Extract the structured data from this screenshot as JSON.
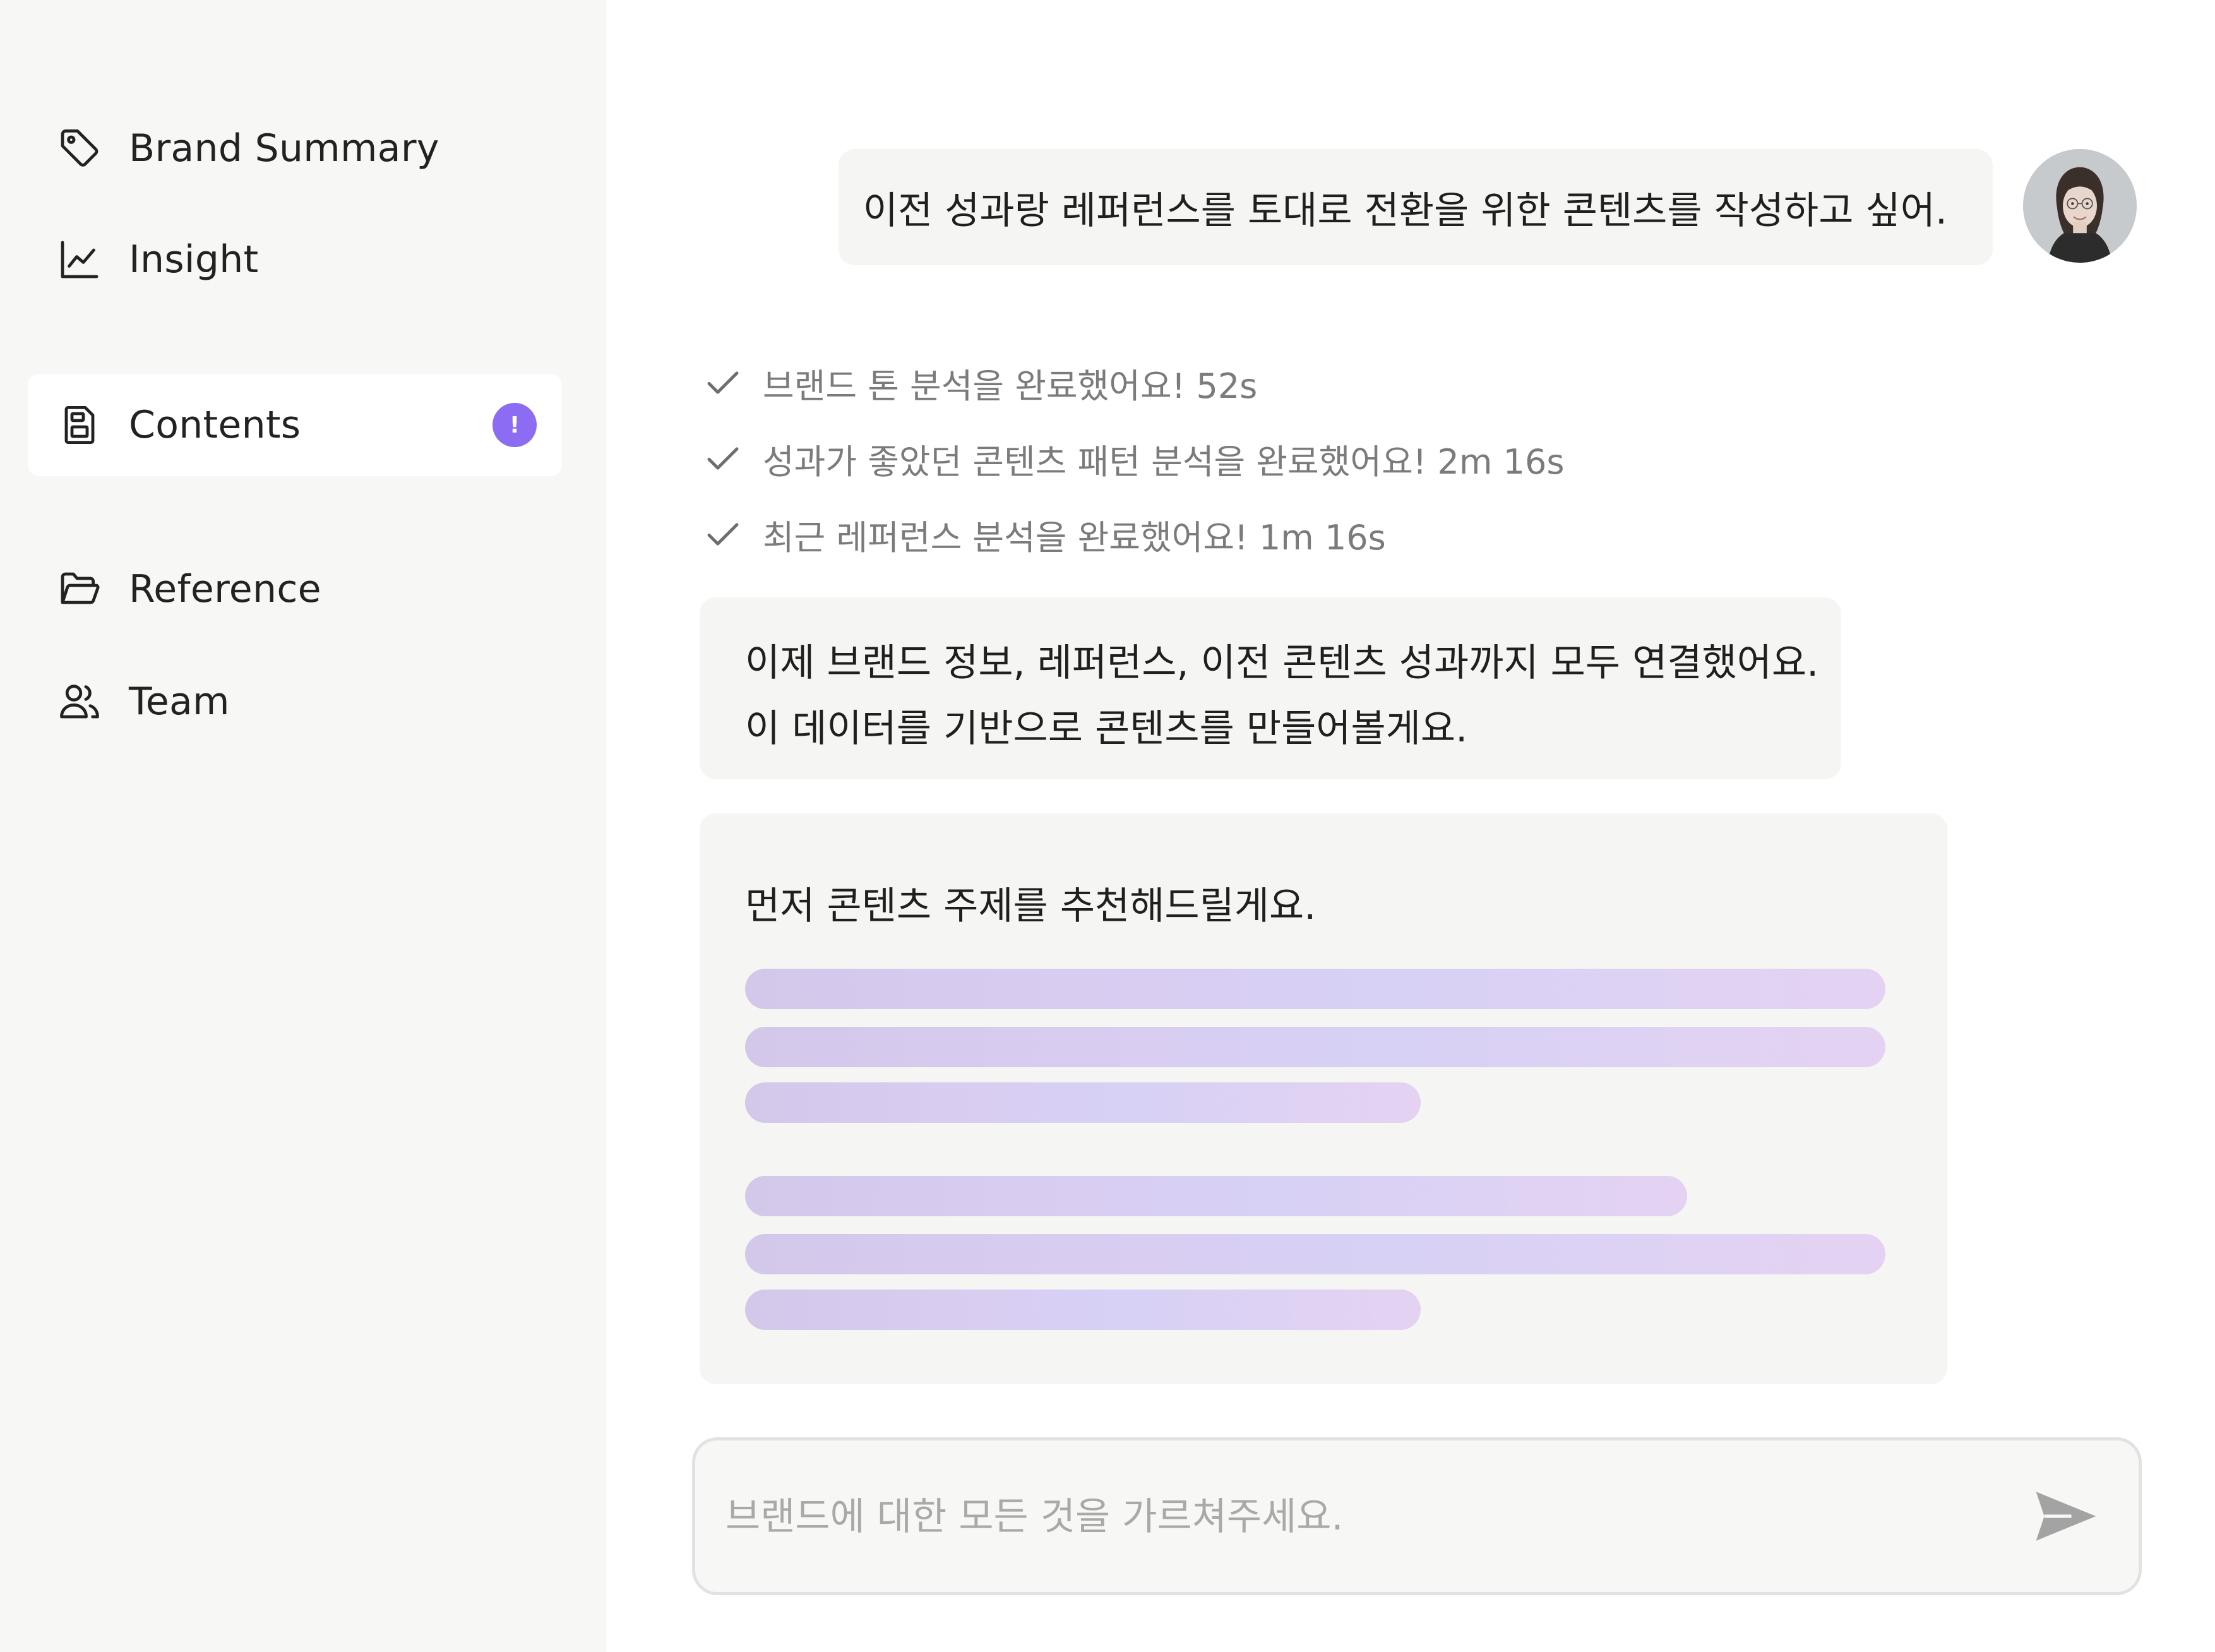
{
  "sidebar": {
    "items": [
      {
        "label": "Brand Summary",
        "icon": "tag-icon"
      },
      {
        "label": "Insight",
        "icon": "line-chart-icon"
      },
      {
        "label": "Contents",
        "icon": "document-icon",
        "active": true,
        "badge": "!"
      },
      {
        "label": "Reference",
        "icon": "folder-open-icon"
      },
      {
        "label": "Team",
        "icon": "users-icon"
      }
    ]
  },
  "chat": {
    "user_message": "이전 성과랑 레퍼런스를 토대로 전환을 위한 콘텐츠를 작성하고 싶어.",
    "status_steps": [
      "브랜드 톤 분석을 완료했어요! 52s",
      "성과가 좋았던 콘텐츠 패턴 분석을 완료했어요! 2m 16s",
      "최근 레퍼런스 분석을 완료했어요! 1m 16s"
    ],
    "bot_message_lines": [
      "이제 브랜드 정보, 레퍼런스, 이전 콘텐츠 성과까지 모두 연결했어요.",
      "이 데이터를 기반으로 콘텐츠를 만들어볼게요."
    ],
    "topic_card_title": "먼저 콘텐츠 주제를 추천해드릴게요."
  },
  "input": {
    "placeholder": "브랜드에 대한 모든 것을 가르쳐주세요.",
    "value": ""
  },
  "colors": {
    "sidebar_bg": "#f7f7f5",
    "bubble_bg": "#f5f5f3",
    "badge": "#8b6cf2",
    "skeleton_start": "#d3c7ea",
    "skeleton_end": "#e5d2f2"
  }
}
